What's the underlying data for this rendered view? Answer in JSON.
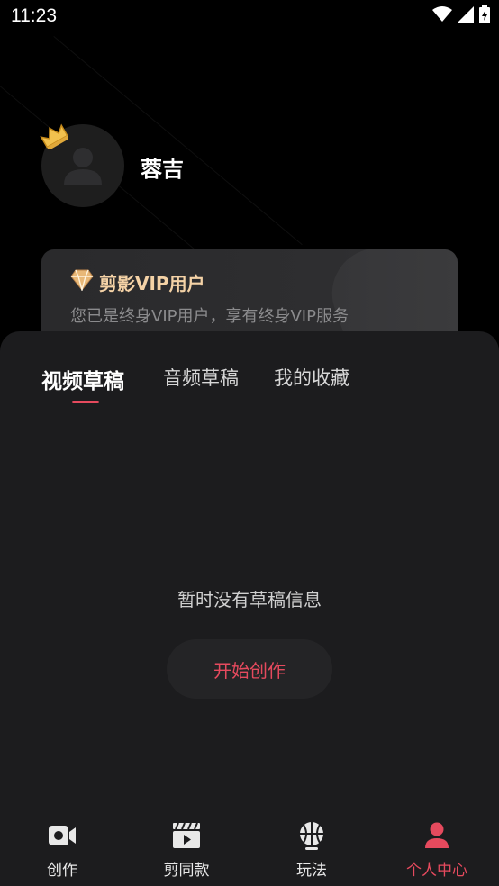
{
  "status_bar": {
    "time": "11:23"
  },
  "profile": {
    "username": "蓉吉"
  },
  "vip": {
    "title": "剪影VIP用户",
    "description": "您已是终身VIP用户，享有终身VIP服务"
  },
  "tabs": [
    {
      "label": "视频草稿",
      "active": true
    },
    {
      "label": "音频草稿",
      "active": false
    },
    {
      "label": "我的收藏",
      "active": false
    }
  ],
  "empty_state": {
    "message": "暂时没有草稿信息",
    "button_label": "开始创作"
  },
  "bottom_nav": [
    {
      "label": "创作",
      "icon": "video-camera-icon",
      "active": false
    },
    {
      "label": "剪同款",
      "icon": "clapperboard-icon",
      "active": false
    },
    {
      "label": "玩法",
      "icon": "basketball-icon",
      "active": false
    },
    {
      "label": "个人中心",
      "icon": "person-icon",
      "active": true
    }
  ],
  "colors": {
    "accent": "#e64a5e",
    "vip_gold": "#f4d2a6",
    "sheet_bg": "#1c1c1e"
  }
}
